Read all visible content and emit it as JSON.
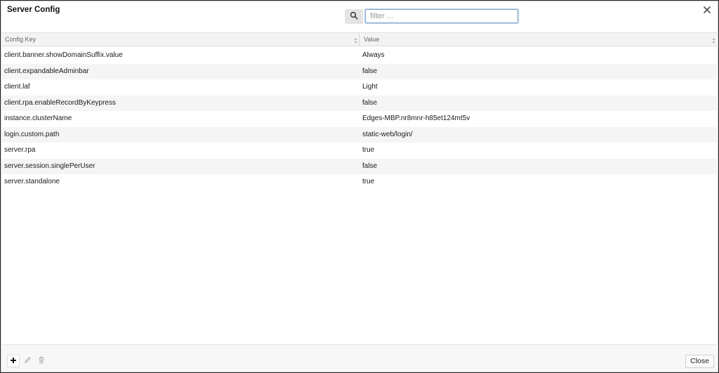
{
  "dialog": {
    "title": "Server Config",
    "close_icon": "close-x-icon"
  },
  "search": {
    "icon": "search-icon",
    "placeholder": "filter ...",
    "value": ""
  },
  "table": {
    "columns": [
      "Config Key",
      "Value"
    ],
    "rows": [
      {
        "key": "client.banner.showDomainSuffix.value",
        "value": "Always"
      },
      {
        "key": "client.expandableAdminbar",
        "value": "false"
      },
      {
        "key": "client.laf",
        "value": "Light"
      },
      {
        "key": "client.rpa.enableRecordByKeypress",
        "value": "false"
      },
      {
        "key": "instance.clusterName",
        "value": "Edges-MBP.nr8mnr-h85et124mt5v"
      },
      {
        "key": "login.custom.path",
        "value": "static-web/login/"
      },
      {
        "key": "server.rpa",
        "value": "true"
      },
      {
        "key": "server.session.singlePerUser",
        "value": "false"
      },
      {
        "key": "server.standalone",
        "value": "true"
      }
    ]
  },
  "footer": {
    "tools": [
      "plus-icon",
      "pencil-icon",
      "trash-icon"
    ],
    "close_label": "Close"
  },
  "colors": {
    "accent_focus": "#7aa7d9",
    "row_stripe": "#f5f5f5"
  }
}
